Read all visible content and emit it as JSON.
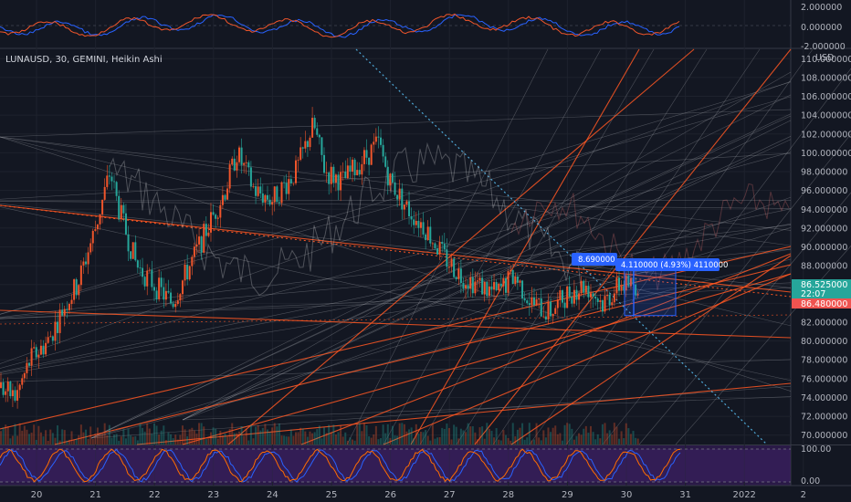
{
  "header": {
    "symbol_title": "LUNAUSD, 30, GEMINI, Heikin Ashi"
  },
  "colors": {
    "background": "#131722",
    "up": "#f0552b",
    "down": "#26a69a",
    "grid": "#1e222d",
    "trendline": "#ff5722",
    "fan": "#b7b9c0",
    "price_tag_teal": "#26a69a",
    "price_tag_red": "#ef5350",
    "measure": "#2962ff",
    "stoch_fill": "#3b1f5f",
    "stoch_k": "#2962ff",
    "stoch_d": "#ff6d00"
  },
  "chart_data": [
    {
      "type": "line",
      "pane": "top-oscillator",
      "yticks": [
        "2.000000",
        "0.000000",
        "-2.000000"
      ],
      "ylim": [
        -2,
        2
      ]
    },
    {
      "type": "candlestick",
      "pane": "main-price",
      "ylabel": "USD",
      "ylim": [
        69,
        111
      ],
      "yticks": [
        "110.000000",
        "108.000000",
        "106.000000",
        "104.000000",
        "102.000000",
        "100.000000",
        "98.000000",
        "96.000000",
        "94.000000",
        "92.000000",
        "90.000000",
        "88.000000",
        "86.000000",
        "84.000000",
        "82.000000",
        "80.000000",
        "78.000000",
        "76.000000",
        "74.000000",
        "72.000000",
        "70.000000"
      ],
      "xticks": [
        "20",
        "21",
        "22",
        "23",
        "24",
        "25",
        "26",
        "27",
        "28",
        "29",
        "30",
        "31",
        "2022",
        "2"
      ],
      "price_tags": [
        {
          "label": "86.525000",
          "value": 86.525,
          "color": "#26a69a"
        },
        {
          "label": "22:07",
          "value": 85.75,
          "color": "#26a69a"
        },
        {
          "label": "86.480000",
          "value": 84.7,
          "color": "#ef5350"
        }
      ],
      "path": [
        [
          0,
          75
        ],
        [
          0.25,
          74
        ],
        [
          0.5,
          78
        ],
        [
          0.8,
          80
        ],
        [
          1.1,
          84
        ],
        [
          1.3,
          86
        ],
        [
          1.6,
          92
        ],
        [
          1.85,
          98
        ],
        [
          2.0,
          94
        ],
        [
          2.3,
          88
        ],
        [
          2.6,
          86
        ],
        [
          2.9,
          84
        ],
        [
          3.2,
          88
        ],
        [
          3.5,
          92
        ],
        [
          3.8,
          96
        ],
        [
          4.0,
          100
        ],
        [
          4.3,
          96
        ],
        [
          4.6,
          95
        ],
        [
          5.0,
          98
        ],
        [
          5.3,
          103
        ],
        [
          5.5,
          98
        ],
        [
          5.8,
          97
        ],
        [
          6.1,
          99
        ],
        [
          6.4,
          101
        ],
        [
          6.6,
          97
        ],
        [
          6.9,
          94
        ],
        [
          7.2,
          92
        ],
        [
          7.5,
          89
        ],
        [
          7.8,
          87
        ],
        [
          8.1,
          86
        ],
        [
          8.4,
          85
        ],
        [
          8.7,
          87
        ],
        [
          9.0,
          84
        ],
        [
          9.3,
          83
        ],
        [
          9.6,
          85
        ],
        [
          9.9,
          86
        ],
        [
          10.2,
          84
        ],
        [
          10.5,
          86
        ],
        [
          10.8,
          85.9
        ]
      ],
      "measure": {
        "start_label": "8.690000",
        "change_label": "4.110000 (4.93%) 4110000"
      }
    },
    {
      "type": "line",
      "pane": "stochastic",
      "yticks": [
        "100.00",
        "0.00"
      ],
      "ylim": [
        0,
        100
      ]
    }
  ]
}
